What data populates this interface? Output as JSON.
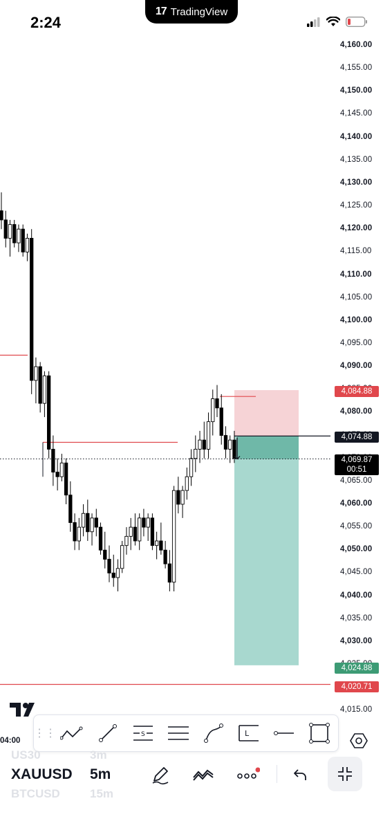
{
  "status_bar": {
    "time": "2:24",
    "island_label": "TradingView"
  },
  "price_axis": {
    "ticks": [
      "4,160.00",
      "4,155.00",
      "4,150.00",
      "4,145.00",
      "4,140.00",
      "4,135.00",
      "4,130.00",
      "4,125.00",
      "4,120.00",
      "4,115.00",
      "4,110.00",
      "4,105.00",
      "4,100.00",
      "4,095.00",
      "4,090.00",
      "4,085.00",
      "4,080.00",
      "4,075.00",
      "4,070.00",
      "4,065.00",
      "4,060.00",
      "4,055.00",
      "4,050.00",
      "4,045.00",
      "4,040.00",
      "4,035.00",
      "4,030.00",
      "4,025.00",
      "4,020.00",
      "4,015.00"
    ],
    "stop_loss_tag": "4,084.88",
    "entry_tag": "4,074.88",
    "current_price": "4,069.87",
    "countdown": "00:51",
    "take_profit_tag": "4,024.88",
    "level_tag": "4,020.71"
  },
  "chart": {
    "candles": [
      [
        4124,
        4128,
        4120,
        4122
      ],
      [
        4122,
        4124,
        4116,
        4118
      ],
      [
        4118,
        4122,
        4114,
        4121
      ],
      [
        4121,
        4122,
        4116,
        4117
      ],
      [
        4117,
        4121,
        4115,
        4120
      ],
      [
        4120,
        4121,
        4114,
        4115
      ],
      [
        4115,
        4119,
        4113,
        4118
      ],
      [
        4118,
        4120,
        4084,
        4087
      ],
      [
        4087,
        4092,
        4082,
        4090
      ],
      [
        4090,
        4091,
        4080,
        4082
      ],
      [
        4082,
        4089,
        4079,
        4088
      ],
      [
        4088,
        4089,
        4070,
        4072
      ],
      [
        4072,
        4075,
        4064,
        4067
      ],
      [
        4067,
        4070,
        4063,
        4066
      ],
      [
        4066,
        4071,
        4065,
        4069
      ],
      [
        4069,
        4070,
        4060,
        4062
      ],
      [
        4062,
        4065,
        4054,
        4056
      ],
      [
        4056,
        4058,
        4050,
        4052
      ],
      [
        4052,
        4057,
        4050,
        4055
      ],
      [
        4055,
        4060,
        4053,
        4058
      ],
      [
        4058,
        4061,
        4052,
        4054
      ],
      [
        4054,
        4058,
        4051,
        4057
      ],
      [
        4057,
        4059,
        4053,
        4055
      ],
      [
        4055,
        4056,
        4049,
        4050
      ],
      [
        4050,
        4054,
        4046,
        4048
      ],
      [
        4048,
        4051,
        4043,
        4045
      ],
      [
        4045,
        4049,
        4042,
        4044
      ],
      [
        4044,
        4048,
        4041,
        4046
      ],
      [
        4046,
        4052,
        4045,
        4051
      ],
      [
        4051,
        4055,
        4049,
        4053
      ],
      [
        4053,
        4057,
        4050,
        4055
      ],
      [
        4055,
        4058,
        4051,
        4052
      ],
      [
        4052,
        4058,
        4050,
        4057
      ],
      [
        4057,
        4059,
        4053,
        4055
      ],
      [
        4055,
        4058,
        4052,
        4057
      ],
      [
        4057,
        4058,
        4050,
        4051
      ],
      [
        4051,
        4054,
        4048,
        4052
      ],
      [
        4052,
        4056,
        4049,
        4050
      ],
      [
        4050,
        4052,
        4046,
        4047
      ],
      [
        4047,
        4050,
        4041,
        4043
      ],
      [
        4043,
        4064,
        4041,
        4063
      ],
      [
        4063,
        4066,
        4058,
        4060
      ],
      [
        4060,
        4064,
        4057,
        4063
      ],
      [
        4063,
        4068,
        4061,
        4066
      ],
      [
        4066,
        4072,
        4064,
        4070
      ],
      [
        4070,
        4075,
        4067,
        4072
      ],
      [
        4072,
        4076,
        4069,
        4074
      ],
      [
        4074,
        4078,
        4070,
        4072
      ],
      [
        4072,
        4080,
        4070,
        4078
      ],
      [
        4078,
        4085,
        4075,
        4083
      ],
      [
        4083,
        4086,
        4079,
        4081
      ],
      [
        4081,
        4084,
        4073,
        4075
      ],
      [
        4075,
        4077,
        4070,
        4072
      ],
      [
        4072,
        4075,
        4069,
        4074
      ],
      [
        4074,
        4076,
        4069,
        4070
      ]
    ]
  },
  "drawings": {
    "resistance_line": "4,073.5",
    "left_level": "4,092.5"
  },
  "toolbar": {
    "handle": "⋮⋮",
    "tools": [
      "trend-angle",
      "trend-line",
      "support-resistance",
      "parallel-channel",
      "path",
      "long-position",
      "horizontal-ray",
      "rectangle"
    ]
  },
  "time_axis_label": "04:00",
  "symbols": {
    "above": "US30",
    "current": "XAUUSD",
    "below": "BTCUSD"
  },
  "timeframes": {
    "above": "3m",
    "current": "5m",
    "below": "15m"
  },
  "colors": {
    "bull": "#ffffff",
    "bear": "#000000",
    "red": "#e0474c",
    "tp_zone": "#a8d8cf",
    "sl_zone": "#f6d3d6"
  }
}
